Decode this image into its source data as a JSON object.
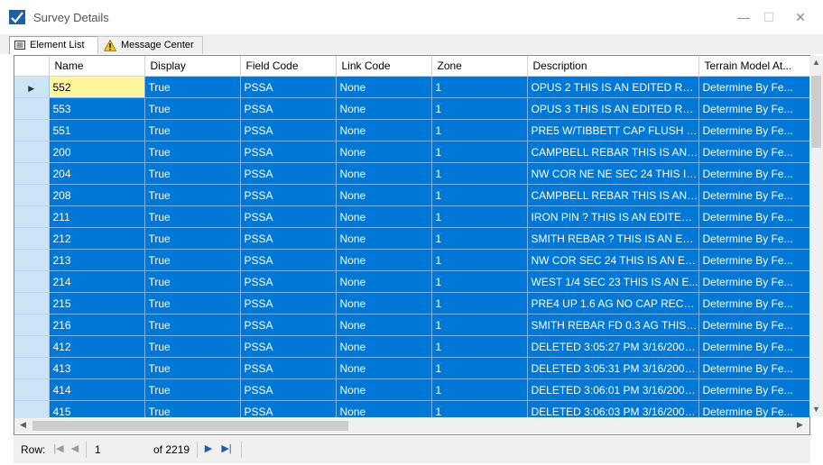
{
  "window": {
    "title": "Survey Details",
    "minimize": "—",
    "maximize": "☐",
    "close": "✕"
  },
  "tabs": [
    {
      "label": "Element List",
      "icon": "list-icon",
      "active": true
    },
    {
      "label": "Message Center",
      "icon": "warning-icon",
      "active": false
    }
  ],
  "columns": [
    "Name",
    "Display",
    "Field Code",
    "Link Code",
    "Zone",
    "Description",
    "Terrain Model At..."
  ],
  "rows": [
    [
      "552",
      "True",
      "PSSA",
      "None",
      "1",
      "OPUS 2 THIS IS AN EDITED REC...",
      "Determine By Fe..."
    ],
    [
      "553",
      "True",
      "PSSA",
      "None",
      "1",
      "OPUS 3 THIS IS AN EDITED REC...",
      "Determine By Fe..."
    ],
    [
      "551",
      "True",
      "PSSA",
      "None",
      "1",
      "PRE5 W/TIBBETT CAP FLUSH T...",
      "Determine By Fe..."
    ],
    [
      "200",
      "True",
      "PSSA",
      "None",
      "1",
      "CAMPBELL REBAR THIS IS AN E...",
      "Determine By Fe..."
    ],
    [
      "204",
      "True",
      "PSSA",
      "None",
      "1",
      "NW COR NE NE SEC 24 THIS IS ...",
      "Determine By Fe..."
    ],
    [
      "208",
      "True",
      "PSSA",
      "None",
      "1",
      "CAMPBELL REBAR THIS IS AN E...",
      "Determine By Fe..."
    ],
    [
      "211",
      "True",
      "PSSA",
      "None",
      "1",
      "IRON PIN ? THIS IS AN EDITED ...",
      "Determine By Fe..."
    ],
    [
      "212",
      "True",
      "PSSA",
      "None",
      "1",
      "SMITH REBAR ? THIS IS AN EDI...",
      "Determine By Fe..."
    ],
    [
      "213",
      "True",
      "PSSA",
      "None",
      "1",
      "NW COR SEC 24 THIS IS AN EDI...",
      "Determine By Fe..."
    ],
    [
      "214",
      "True",
      "PSSA",
      "None",
      "1",
      "WEST 1/4 SEC 23 THIS IS AN E...",
      "Determine By Fe..."
    ],
    [
      "215",
      "True",
      "PSSA",
      "None",
      "1",
      "PRE4 UP 1.6 AG NO CAP RECEI...",
      "Determine By Fe..."
    ],
    [
      "216",
      "True",
      "PSSA",
      "None",
      "1",
      "SMITH REBAR FD 0.3 AG THIS I...",
      "Determine By Fe..."
    ],
    [
      "412",
      "True",
      "PSSA",
      "None",
      "1",
      "DELETED 3:05:27 PM 3/16/2009 ...",
      "Determine By Fe..."
    ],
    [
      "413",
      "True",
      "PSSA",
      "None",
      "1",
      "DELETED 3:05:31 PM 3/16/2009 ...",
      "Determine By Fe..."
    ],
    [
      "414",
      "True",
      "PSSA",
      "None",
      "1",
      "DELETED 3:06:01 PM 3/16/2009 ...",
      "Determine By Fe..."
    ],
    [
      "415",
      "True",
      "PSSA",
      "None",
      "1",
      "DELETED 3:06:03 PM 3/16/2009 ...",
      "Determine By Fe..."
    ]
  ],
  "current_row_index": 0,
  "navigator": {
    "row_label": "Row:",
    "position": "1",
    "of_label": "of 2219"
  },
  "colors": {
    "selection": "#0078d7",
    "current_cell": "#fff59d",
    "row_header": "#cde4f7"
  }
}
